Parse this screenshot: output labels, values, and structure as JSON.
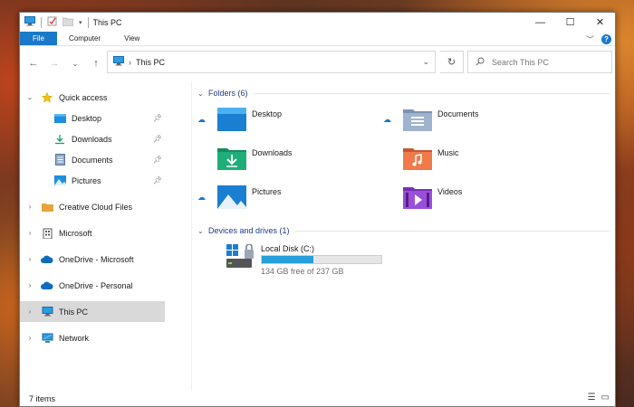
{
  "window": {
    "title": "This PC"
  },
  "ribbon": {
    "tabs": [
      "File",
      "Computer",
      "View"
    ],
    "help": "?"
  },
  "address": {
    "location": "This PC"
  },
  "search": {
    "placeholder": "Search This PC"
  },
  "sidebar": {
    "quick_access": "Quick access",
    "quick_items": [
      "Desktop",
      "Downloads",
      "Documents",
      "Pictures"
    ],
    "creative_cloud": "Creative Cloud Files",
    "microsoft": "Microsoft",
    "onedrive_ms": "OneDrive - Microsoft",
    "onedrive_personal": "OneDrive - Personal",
    "this_pc": "This PC",
    "network": "Network"
  },
  "main": {
    "folders_header": "Folders (6)",
    "folders": [
      "Desktop",
      "Documents",
      "Downloads",
      "Music",
      "Pictures",
      "Videos"
    ],
    "drives_header": "Devices and drives (1)",
    "drive": {
      "name": "Local Disk (C:)",
      "free_text": "134 GB free of 237 GB",
      "used_fraction": 0.43
    }
  },
  "status": {
    "items": "7 items"
  },
  "colors": {
    "accent": "#1979ca",
    "drive_bar": "#26a0da"
  }
}
